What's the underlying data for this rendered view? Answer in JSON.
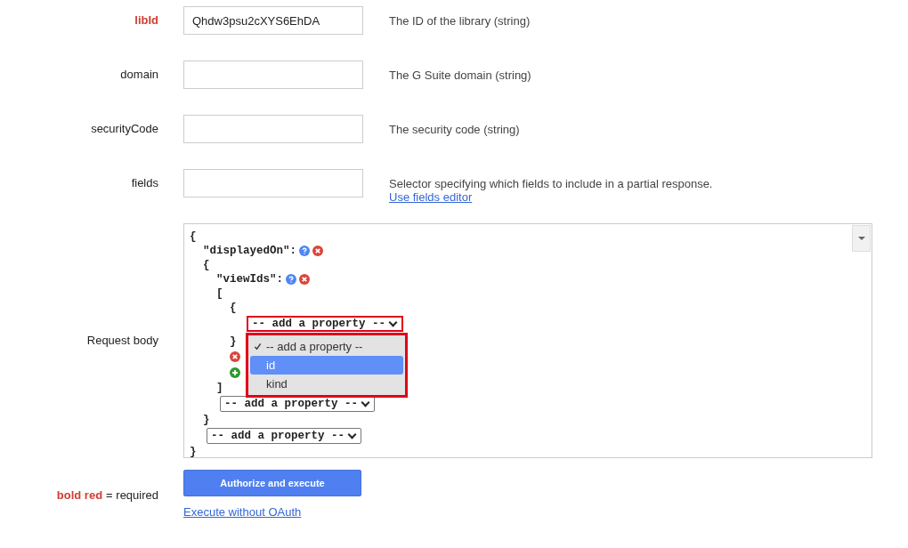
{
  "params": [
    {
      "name": "libId",
      "required": true,
      "value": "Qhdw3psu2cXYS6EhDA",
      "description": "The ID of the library (string)"
    },
    {
      "name": "domain",
      "required": false,
      "description": "The G Suite domain (string)"
    },
    {
      "name": "securityCode",
      "required": false,
      "description": "The security code (string)"
    },
    {
      "name": "fields",
      "required": false,
      "description": "Selector specifying which fields to include in a partial response.",
      "link": "Use fields editor"
    }
  ],
  "request_body": {
    "label": "Request body",
    "root": {
      "kind": "block",
      "open": "{",
      "close": "}",
      "children": [
        {
          "kind": "key",
          "text": "\"displayedOn\":",
          "help": true,
          "removable": true
        },
        {
          "kind": "block",
          "open": "{",
          "close": "}",
          "children": [
            {
              "kind": "key",
              "text": "\"viewIds\":",
              "help": true,
              "removable": true
            },
            {
              "kind": "block",
              "open": "[",
              "close": "]",
              "children": [
                {
                  "kind": "block",
                  "open": "{",
                  "close": "}",
                  "children": [
                    {
                      "kind": "select",
                      "text": "-- add a property --",
                      "open": true,
                      "options": [
                        {
                          "label": "-- add a property --",
                          "selected": true,
                          "highlighted": false
                        },
                        {
                          "label": "id",
                          "selected": false,
                          "highlighted": true
                        },
                        {
                          "label": "kind",
                          "selected": false,
                          "highlighted": false
                        }
                      ]
                    }
                  ]
                },
                {
                  "kind": "remove"
                },
                {
                  "kind": "add"
                }
              ]
            },
            {
              "kind": "select",
              "text": "-- add a property --",
              "open": false
            }
          ]
        },
        {
          "kind": "select",
          "text": "-- add a property --",
          "open": false
        }
      ]
    }
  },
  "legend": {
    "marker": "bold red",
    "text": "= required"
  },
  "actions": {
    "primary": "Authorize and execute",
    "link": "Execute without OAuth"
  }
}
